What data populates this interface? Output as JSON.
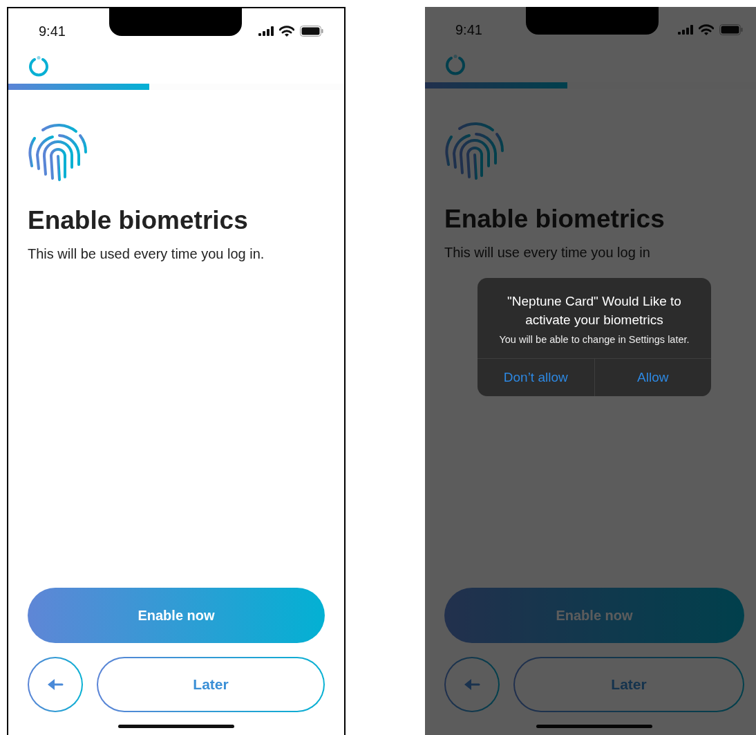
{
  "screens": [
    {
      "status_time": "9:41",
      "progress": {
        "level": 0.42
      },
      "title": "Enable biometrics",
      "subtitle": "This will be used every time you log in.",
      "primary_button": "Enable now",
      "secondary_button": "Later",
      "dimmed": false
    },
    {
      "status_time": "9:41",
      "progress": {
        "level": 0.42
      },
      "title": "Enable biometrics",
      "subtitle": "This will use every time you log in",
      "primary_button": "Enable now",
      "secondary_button": "Later",
      "dimmed": true,
      "alert": {
        "title": "\"Neptune Card\" Would Like to activate your biometrics",
        "message": "You will be able to change in Settings later.",
        "buttons": [
          "Don’t allow",
          "Allow"
        ]
      }
    }
  ]
}
